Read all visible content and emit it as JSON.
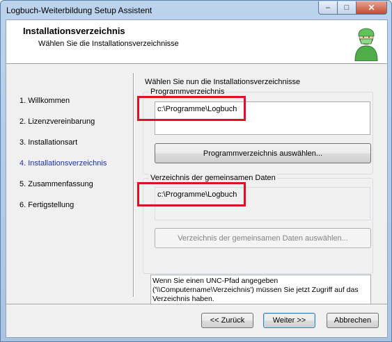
{
  "window": {
    "title": "Logbuch-Weiterbildung Setup Assistent",
    "controls": {
      "minimize": "–",
      "maximize": "□",
      "close": "✕"
    }
  },
  "header": {
    "title": "Installationsverzeichnis",
    "subtitle": "Wählen Sie die Installationsverzeichnisse",
    "logo_icon": "surgeon-icon"
  },
  "steps": [
    {
      "label": "1. Willkommen",
      "active": false
    },
    {
      "label": "2. Lizenzvereinbarung",
      "active": false
    },
    {
      "label": "3. Installationsart",
      "active": false
    },
    {
      "label": "4. Installationsverzeichnis",
      "active": true
    },
    {
      "label": "5. Zusammenfassung",
      "active": false
    },
    {
      "label": "6. Fertigstellung",
      "active": false
    }
  ],
  "content": {
    "intro": "Wählen Sie nun die Installationsverzeichnisse",
    "program_group": {
      "label": "Programmverzeichnis",
      "path": "c:\\Programme\\Logbuch",
      "button": "Programmverzeichnis auswählen..."
    },
    "shared_group": {
      "label": "Verzeichnis der gemeinsamen Daten",
      "path": "c:\\Programme\\Logbuch",
      "button": "Verzeichnis der gemeinsamen Daten auswählen..."
    },
    "info_text": "Wenn Sie einen UNC-Pfad angegeben ('\\\\Computername\\Verzeichnis') müssen Sie jetzt Zugriff auf das Verzeichnis haben."
  },
  "footer": {
    "back": "<< Zurück",
    "next": "Weiter >>",
    "cancel": "Abbrechen"
  },
  "colors": {
    "highlight": "#e01020",
    "active_step": "#1c2fa8"
  }
}
